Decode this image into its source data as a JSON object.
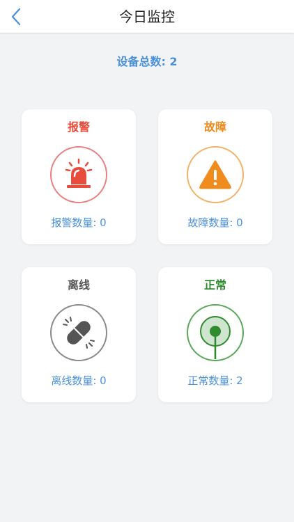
{
  "header": {
    "title": "今日监控",
    "back_icon": "chevron-left-icon"
  },
  "summary": {
    "total_text": "设备总数: 2"
  },
  "colors": {
    "accent": "#4a90d9",
    "alarm": "#e74c3c",
    "fault": "#f08c1e",
    "offline": "#555555",
    "normal": "#2e8b2e"
  },
  "cards": [
    {
      "title": "报警",
      "count_text": "报警数量: 0",
      "icon": "alarm-siren-icon"
    },
    {
      "title": "故障",
      "count_text": "故障数量: 0",
      "icon": "warning-triangle-icon"
    },
    {
      "title": "离线",
      "count_text": "离线数量: 0",
      "icon": "broken-link-icon"
    },
    {
      "title": "正常",
      "count_text": "正常数量: 2",
      "icon": "signal-pin-icon"
    }
  ]
}
